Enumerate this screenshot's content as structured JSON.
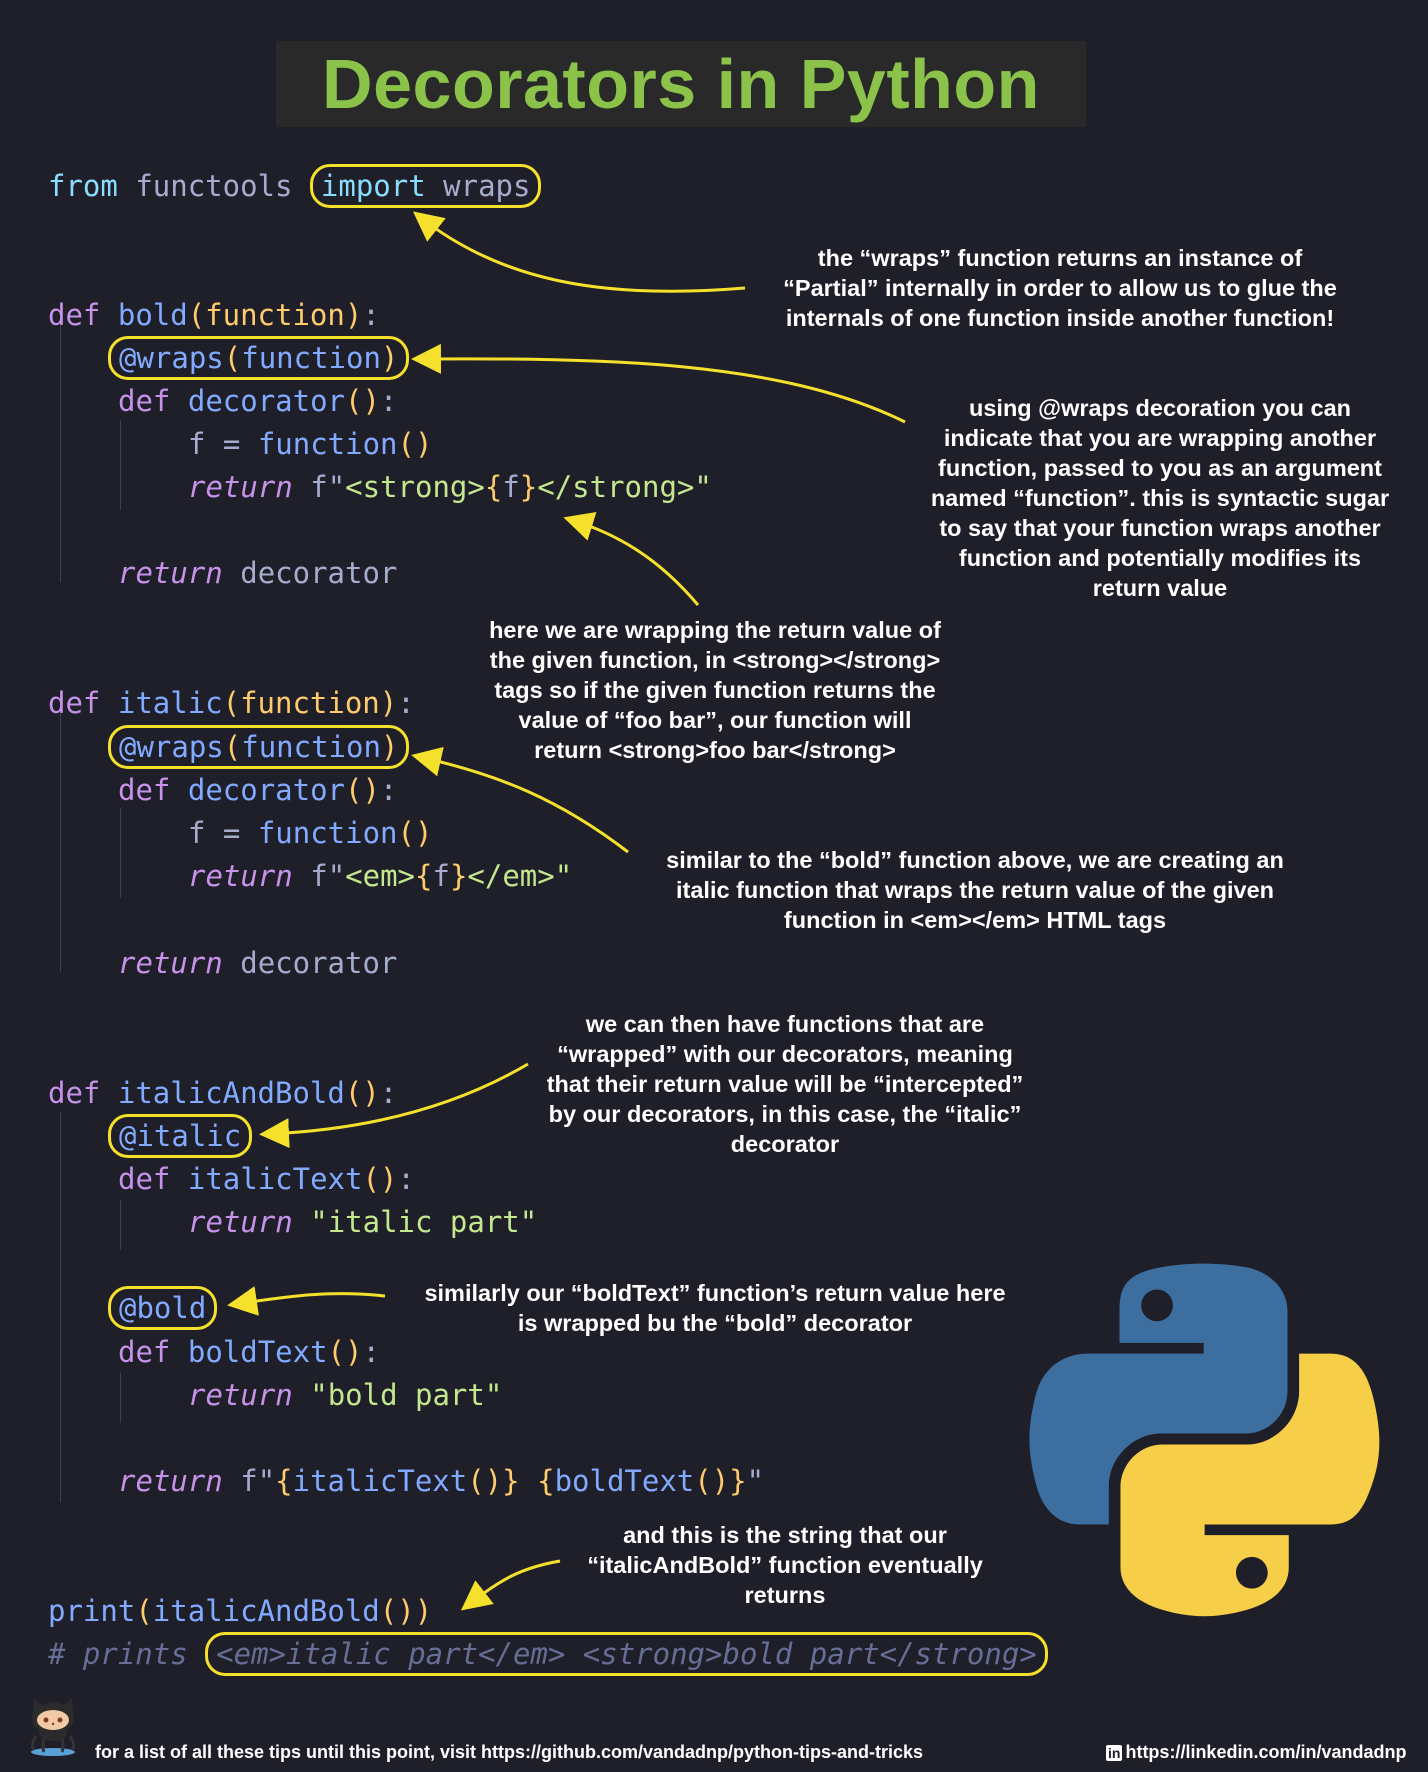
{
  "title": "Decorators in Python",
  "code": {
    "l1_from": "from",
    "l1_module": "functools",
    "l1_import": "import",
    "l1_name": "wraps",
    "def": "def",
    "bold_name": "bold",
    "italic_name": "italic",
    "italic_and_bold_name": "italicAndBold",
    "open_paren": "(",
    "close_paren": ")",
    "param": "function",
    "colon": ":",
    "wraps_decorator": "@wraps",
    "decorator_name": "decorator",
    "empty_parens": "()",
    "f_assign": "f = ",
    "function_call": "function",
    "return_kw": "return",
    "f_prefix": "f\"",
    "strong_open": "<strong>",
    "strong_close": "</strong>\"",
    "em_open": "<em>",
    "em_close": "</em>\"",
    "brace_open": "{",
    "brace_close": "}",
    "f_var": "f",
    "italic_decorator": "@italic",
    "italic_text_fn": "italicText",
    "italic_part_str": "\"italic part\"",
    "bold_decorator": "@bold",
    "bold_text_fn": "boldText",
    "bold_part_str": "\"bold part\"",
    "space": " ",
    "close_quote": "\"",
    "print_fn": "print",
    "comment_prefix": "# prints",
    "comment_output": "<em>italic part</em> <strong>bold part</strong>"
  },
  "notes": {
    "wraps": [
      "the “wraps” function returns an instance of",
      "“Partial” internally in order to allow us to glue the",
      "internals of one function inside another function!"
    ],
    "wraps_decoration": [
      "using @wraps decoration you can",
      "indicate that you are wrapping another",
      "function, passed to you as an argument",
      "named “function”. this is syntactic sugar",
      "to say that your function wraps another",
      "function and potentially modifies its",
      "return value"
    ],
    "strong": [
      "here we are wrapping the return value of",
      "the given function, in <strong></strong>",
      "tags so if the given function returns the",
      "value of “foo bar”, our function will",
      "return <strong>foo bar</strong>"
    ],
    "italic": [
      "similar to the “bold” function above, we are creating an",
      "italic function that wraps the return value of the given",
      "function in <em></em> HTML tags"
    ],
    "wrapped": [
      "we can then have functions that are",
      "“wrapped” with our decorators, meaning",
      "that their return value will be “intercepted”",
      "by our decorators, in this case, the “italic”",
      "decorator"
    ],
    "bold_text": [
      "similarly our “boldText” function’s return value here",
      "is wrapped bu the “bold” decorator"
    ],
    "result": [
      "and this is the string that our",
      "“italicAndBold” function eventually",
      "returns"
    ]
  },
  "footer": {
    "tips": "for a list of all these tips until this point, visit https://github.com/vandadnp/python-tips-and-tricks",
    "linkedin_badge": "in",
    "linkedin": "https://linkedin.com/in/vandadnp"
  },
  "colors": {
    "background": "#1f1f2a",
    "title": "#8bc34a",
    "highlight": "#f5e02c",
    "python_blue": "#3c6e9f",
    "python_yellow": "#f6ce47"
  },
  "icons": [
    "python-logo-icon",
    "octocat-icon",
    "linkedin-icon"
  ]
}
